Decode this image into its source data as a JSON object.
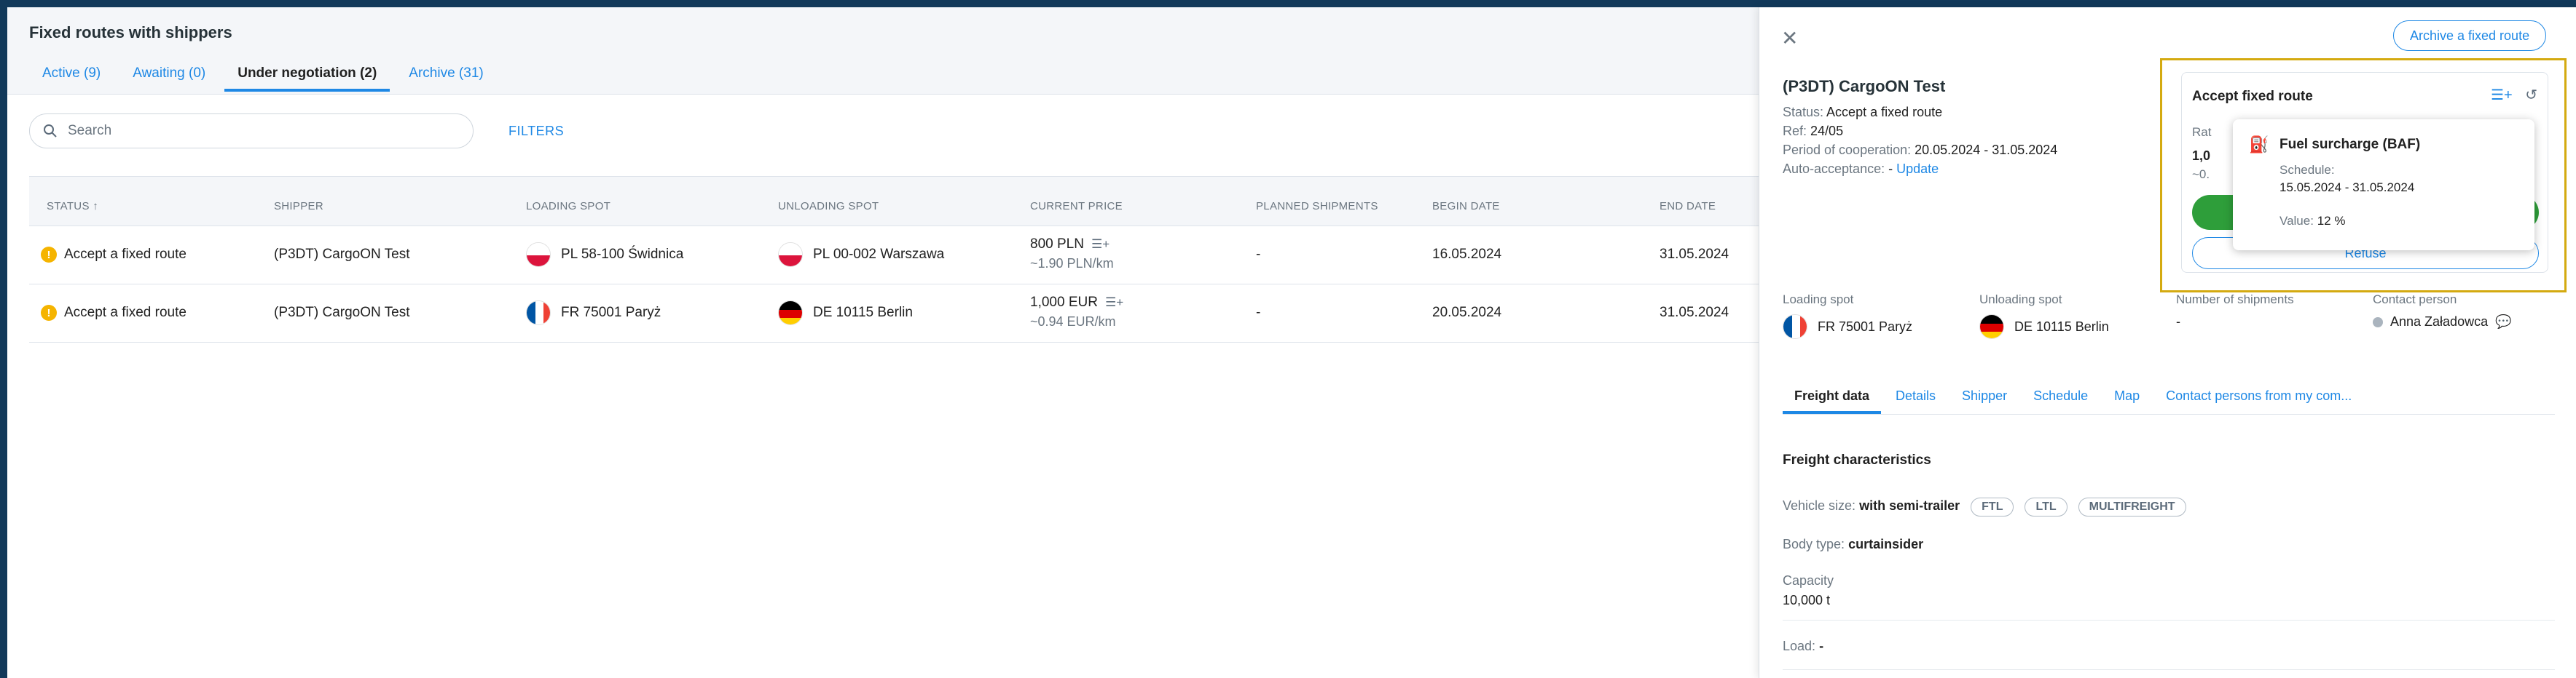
{
  "page": {
    "title": "Fixed routes with shippers",
    "tabs": [
      {
        "label": "Active (9)"
      },
      {
        "label": "Awaiting (0)"
      },
      {
        "label": "Under negotiation (2)"
      },
      {
        "label": "Archive (31)"
      }
    ],
    "active_tab": 2,
    "search_placeholder": "Search",
    "filters_label": "FILTERS"
  },
  "table": {
    "columns": [
      "STATUS",
      "SHIPPER",
      "LOADING SPOT",
      "UNLOADING SPOT",
      "CURRENT PRICE",
      "PLANNED SHIPMENTS",
      "BEGIN DATE",
      "END DATE"
    ],
    "sort_indicator": "↑",
    "rows": [
      {
        "status": "Accept a fixed route",
        "shipper": "(P3DT) CargoON Test",
        "loading": "PL 58-100 Świdnica",
        "loading_flag": "pl",
        "unloading": "PL 00-002 Warszawa",
        "unloading_flag": "pl",
        "price": "800 PLN",
        "price_sub": "~1.90 PLN/km",
        "planned": "-",
        "begin": "16.05.2024",
        "end": "31.05.2024"
      },
      {
        "status": "Accept a fixed route",
        "shipper": "(P3DT) CargoON Test",
        "loading": "FR 75001 Paryż",
        "loading_flag": "fr",
        "unloading": "DE 10115 Berlin",
        "unloading_flag": "de",
        "price": "1,000 EUR",
        "price_sub": "~0.94 EUR/km",
        "planned": "-",
        "begin": "20.05.2024",
        "end": "31.05.2024"
      }
    ]
  },
  "panel": {
    "archive_button": "Archive a fixed route",
    "title": "(P3DT) CargoON Test",
    "status_label": "Status:",
    "status_value": "Accept a fixed route",
    "ref_label": "Ref:",
    "ref_value": "24/05",
    "period_label": "Period of cooperation:",
    "period_value": "20.05.2024 - 31.05.2024",
    "auto_label": "Auto-acceptance:",
    "auto_value": "-",
    "auto_link": "Update",
    "accept": {
      "title": "Accept fixed route",
      "rate_label": "Rat",
      "rate_value": "1,0",
      "rate_sub": "~0.",
      "refuse": "Refuse"
    },
    "tooltip": {
      "title": "Fuel surcharge (BAF)",
      "schedule_label": "Schedule:",
      "schedule_value": "15.05.2024 - 31.05.2024",
      "value_label": "Value:",
      "value": "12 %"
    },
    "info": {
      "loading_label": "Loading spot",
      "loading_value": "FR 75001 Paryż",
      "unloading_label": "Unloading spot",
      "unloading_value": "DE 10115 Berlin",
      "shipments_label": "Number of shipments",
      "shipments_value": "-",
      "contact_label": "Contact person",
      "contact_value": "Anna Załadowca"
    },
    "tabs": [
      "Freight data",
      "Details",
      "Shipper",
      "Schedule",
      "Map",
      "Contact persons from my com..."
    ],
    "freight": {
      "section_title": "Freight characteristics",
      "vehicle_label": "Vehicle size:",
      "vehicle_value": "with semi-trailer",
      "chips": [
        "FTL",
        "LTL",
        "MULTIFREIGHT"
      ],
      "body_label": "Body type:",
      "body_value": "curtainsider",
      "capacity_label": "Capacity",
      "capacity_value": "10,000 t",
      "load_label": "Load:",
      "load_value": "-"
    }
  },
  "colors": {
    "accent": "#1e88e5",
    "warning": "#f5b400",
    "success": "#2e9e3a",
    "highlight_frame": "#d4aa10"
  }
}
